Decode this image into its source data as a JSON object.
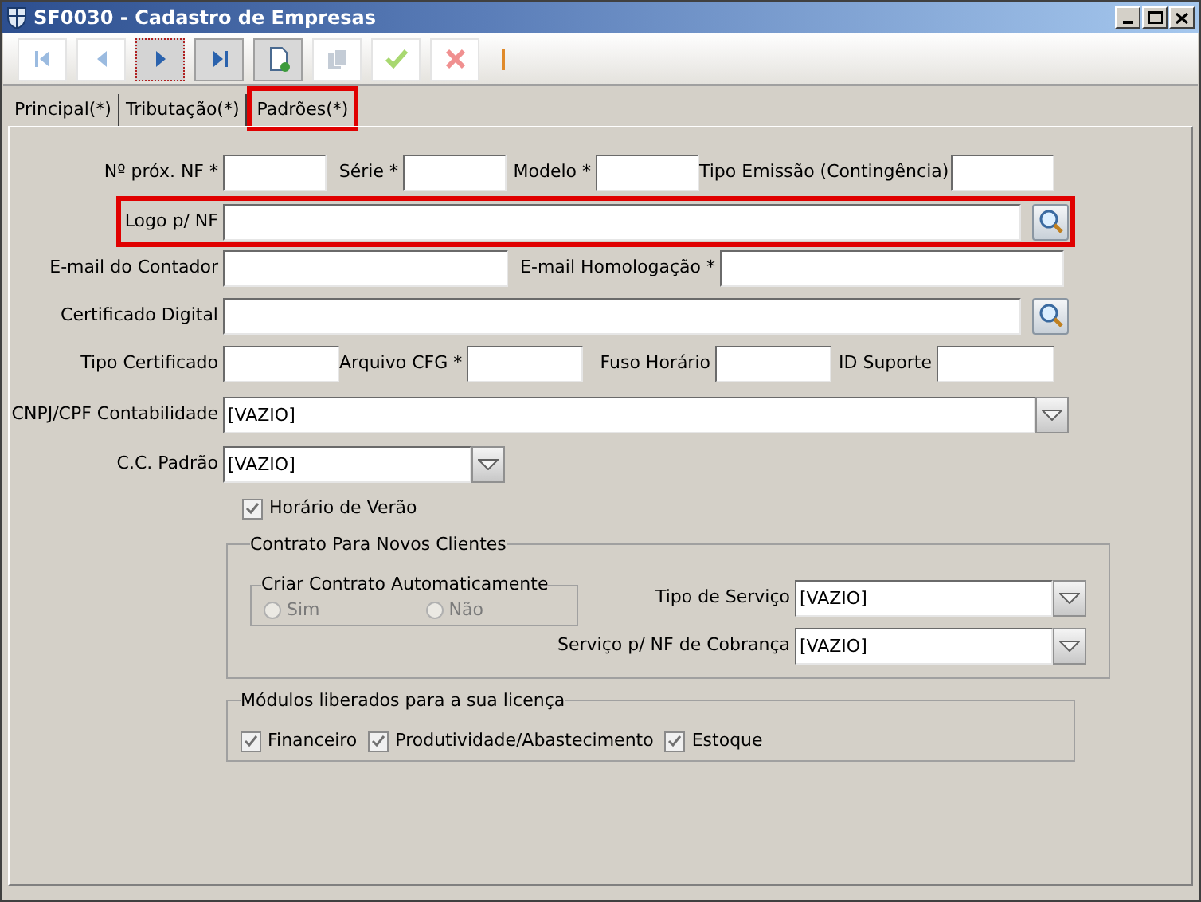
{
  "window": {
    "title": "SF0030 - Cadastro de Empresas"
  },
  "toolbar": [
    {
      "kind": "first",
      "disabled": true,
      "focused": false
    },
    {
      "kind": "previous",
      "disabled": true,
      "focused": false
    },
    {
      "kind": "next",
      "disabled": false,
      "focused": true
    },
    {
      "kind": "last",
      "disabled": false,
      "focused": false
    },
    {
      "kind": "new",
      "disabled": false,
      "focused": false
    },
    {
      "kind": "copy",
      "disabled": true,
      "focused": false
    },
    {
      "kind": "save",
      "disabled": true,
      "focused": false
    },
    {
      "kind": "cancel",
      "disabled": true,
      "focused": false
    }
  ],
  "tabs": [
    {
      "label": "Principal(*)",
      "selected": false,
      "highlighted": false
    },
    {
      "label": "Tributação(*)",
      "selected": false,
      "highlighted": false
    },
    {
      "label": "Padrões(*)",
      "selected": true,
      "highlighted": true
    }
  ],
  "form_rows": [
    {
      "highlighted": false,
      "fields": [
        {
          "label": "Nº próx. NF *",
          "kind": "text"
        },
        {
          "label": "Série *",
          "kind": "text"
        },
        {
          "label": "Modelo *",
          "kind": "text"
        },
        {
          "label": "Tipo Emissão (Contingência)",
          "kind": "text"
        }
      ]
    },
    {
      "highlighted": true,
      "fields": [
        {
          "label": "Logo p/ NF",
          "kind": "lookup"
        }
      ]
    },
    {
      "highlighted": false,
      "fields": [
        {
          "label": "E-mail do Contador",
          "kind": "text"
        },
        {
          "label": "E-mail Homologação *",
          "kind": "text"
        }
      ]
    },
    {
      "highlighted": false,
      "fields": [
        {
          "label": "Certificado Digital",
          "kind": "lookup"
        }
      ]
    },
    {
      "highlighted": false,
      "fields": [
        {
          "label": "Tipo Certificado",
          "kind": "text"
        },
        {
          "label": "Arquivo CFG *",
          "kind": "text"
        },
        {
          "label": "Fuso Horário",
          "kind": "text"
        },
        {
          "label": "ID Suporte",
          "kind": "text"
        }
      ]
    },
    {
      "highlighted": false,
      "fields": [
        {
          "label": "CNPJ/CPF Contabilidade",
          "kind": "combo",
          "value": "[VAZIO]"
        }
      ]
    },
    {
      "highlighted": false,
      "fields": [
        {
          "label": "C.C. Padrão",
          "kind": "combo",
          "value": "[VAZIO]"
        }
      ]
    }
  ],
  "daylight_saving": {
    "label": "Horário de Verão",
    "checked": true
  },
  "contract_group": {
    "title": "Contrato Para Novos Clientes",
    "auto_group": {
      "title": "Criar Contrato Automaticamente",
      "options": [
        {
          "label": "Sim",
          "selected": false,
          "disabled": true
        },
        {
          "label": "Não",
          "selected": false,
          "disabled": true
        }
      ]
    },
    "fields": [
      {
        "label": "Tipo de Serviço",
        "value": "[VAZIO]"
      },
      {
        "label": "Serviço p/ NF de Cobrança",
        "value": "[VAZIO]"
      }
    ]
  },
  "modules_group": {
    "title": "Módulos liberados para a sua licença",
    "items": [
      {
        "label": "Financeiro",
        "checked": true
      },
      {
        "label": "Produtividade/Abastecimento",
        "checked": true
      },
      {
        "label": "Estoque",
        "checked": true
      }
    ]
  }
}
